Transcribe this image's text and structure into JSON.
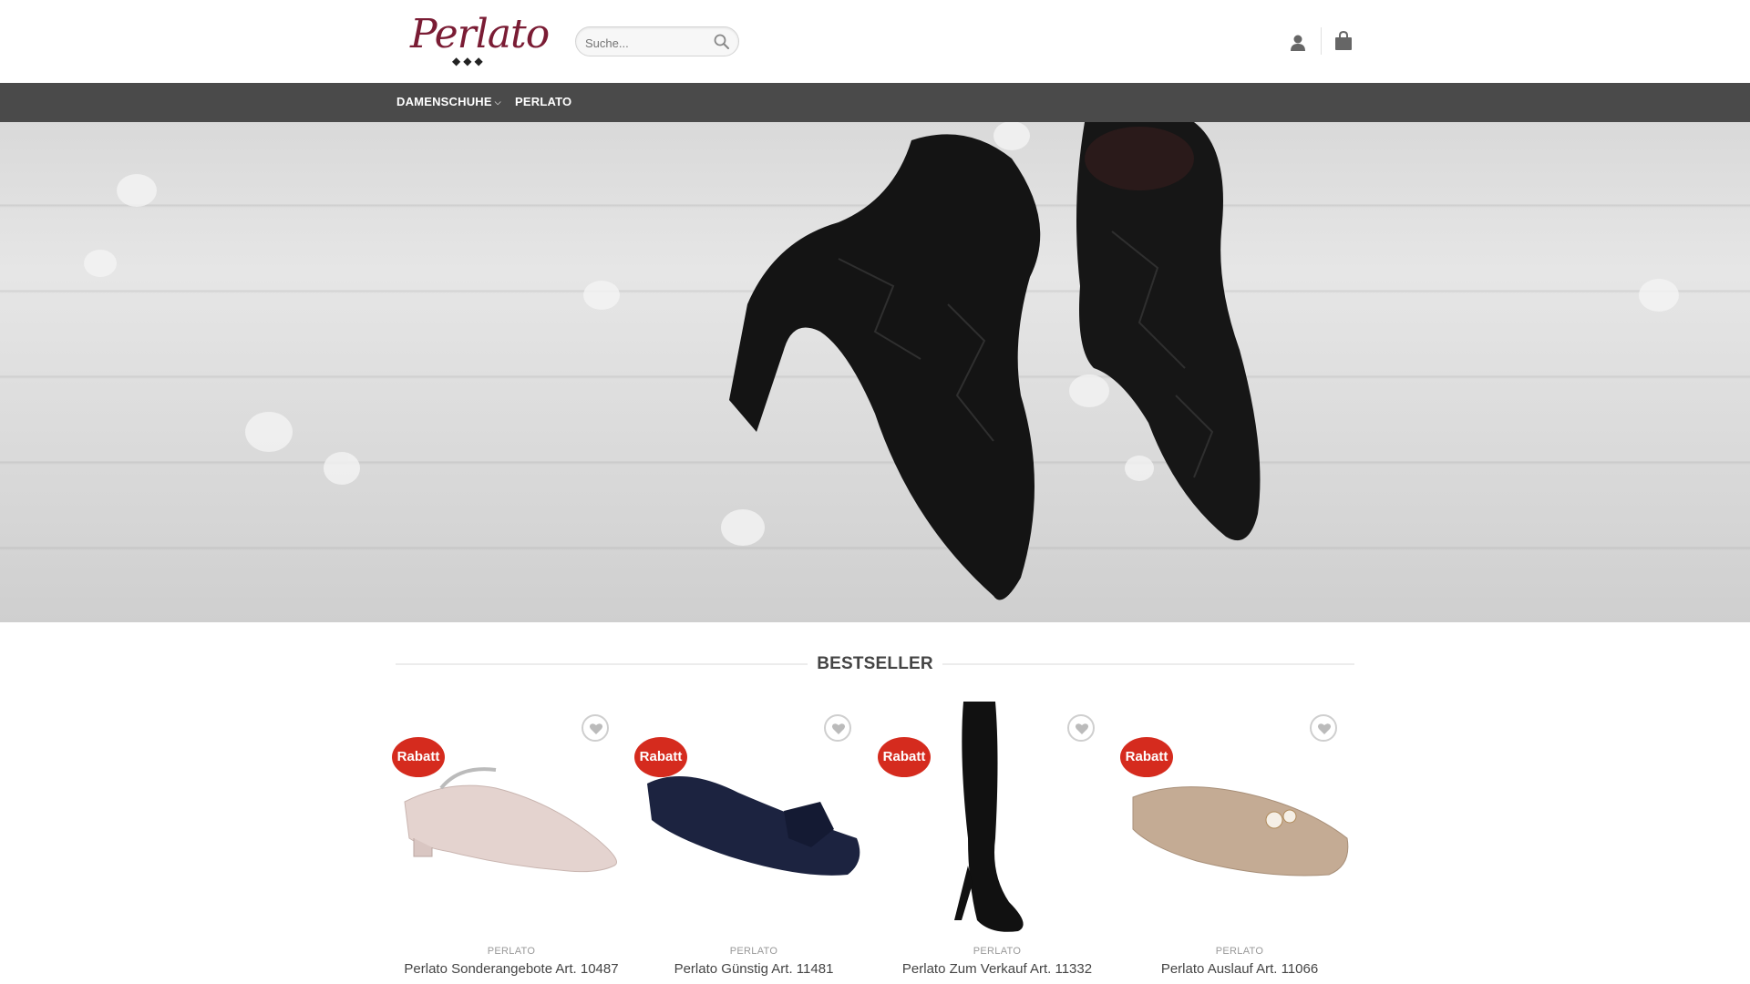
{
  "header": {
    "logo_text": "Perlato",
    "logo_dots": "◆◆◆",
    "search_placeholder": "Suche...",
    "account_icon": "user-icon",
    "cart_icon": "shopping-bag-icon"
  },
  "nav": {
    "items": [
      {
        "label": "DAMENSCHUHE",
        "has_dropdown": true
      },
      {
        "label": "PERLATO",
        "has_dropdown": false
      }
    ]
  },
  "section": {
    "title": "BESTSELLER"
  },
  "products": [
    {
      "badge": "Rabatt",
      "brand": "PERLATO",
      "name": "Perlato Sonderangebote Art. 10487"
    },
    {
      "badge": "Rabatt",
      "brand": "PERLATO",
      "name": "Perlato Günstig Art. 11481"
    },
    {
      "badge": "Rabatt",
      "brand": "PERLATO",
      "name": "Perlato Zum Verkauf Art. 11332"
    },
    {
      "badge": "Rabatt",
      "brand": "PERLATO",
      "name": "Perlato Auslauf Art. 11066"
    }
  ],
  "colors": {
    "brand": "#7a1c34",
    "navbar": "#4a4a4a",
    "badge": "#d52b1e"
  }
}
